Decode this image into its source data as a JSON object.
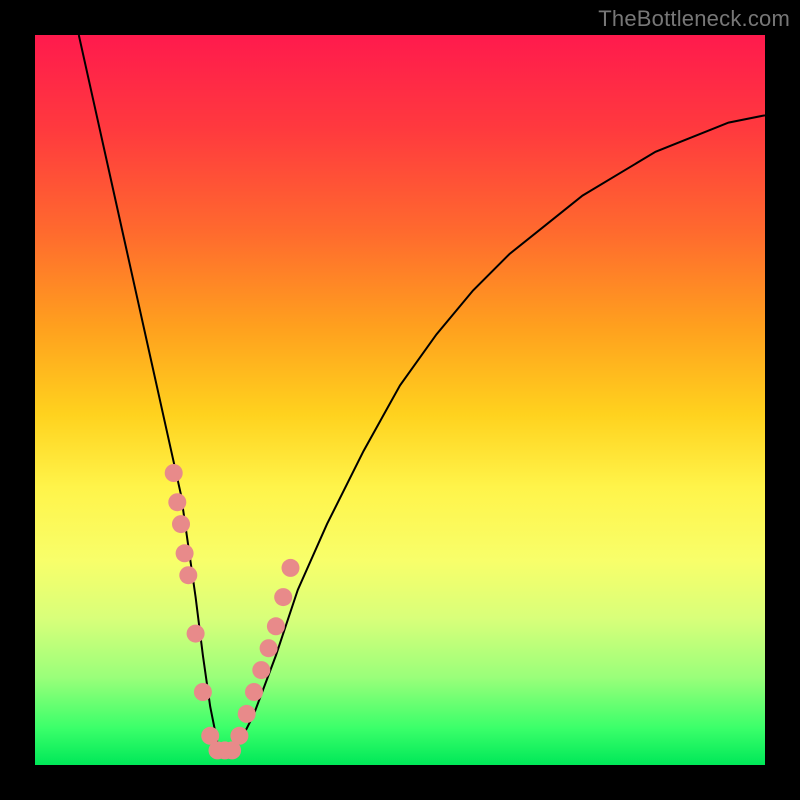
{
  "watermark": "TheBottleneck.com",
  "chart_data": {
    "type": "line",
    "title": "",
    "xlabel": "",
    "ylabel": "",
    "xlim": [
      0,
      100
    ],
    "ylim": [
      0,
      100
    ],
    "series": [
      {
        "name": "bottleneck-curve",
        "x": [
          6,
          8,
          10,
          12,
          14,
          16,
          18,
          20,
          22,
          23,
          24,
          25,
          26,
          27,
          28,
          30,
          33,
          36,
          40,
          45,
          50,
          55,
          60,
          65,
          70,
          75,
          80,
          85,
          90,
          95,
          100
        ],
        "values": [
          100,
          91,
          82,
          73,
          64,
          55,
          46,
          37,
          23,
          15,
          8,
          3,
          2,
          2,
          3,
          7,
          15,
          24,
          33,
          43,
          52,
          59,
          65,
          70,
          74,
          78,
          81,
          84,
          86,
          88,
          89
        ]
      }
    ],
    "markers": {
      "name": "highlight-points",
      "x": [
        19.0,
        19.5,
        20.0,
        20.5,
        21.0,
        22.0,
        23.0,
        24.0,
        25.0,
        26.0,
        27.0,
        28.0,
        29.0,
        30.0,
        31.0,
        32.0,
        33.0,
        34.0,
        35.0
      ],
      "values": [
        40,
        36,
        33,
        29,
        26,
        18,
        10,
        4,
        2,
        2,
        2,
        4,
        7,
        10,
        13,
        16,
        19,
        23,
        27
      ]
    },
    "background_gradient": {
      "top": "#ff1a4d",
      "bottom": "#00e858"
    },
    "marker_color": "#e88a8a",
    "curve_color": "#000000"
  }
}
